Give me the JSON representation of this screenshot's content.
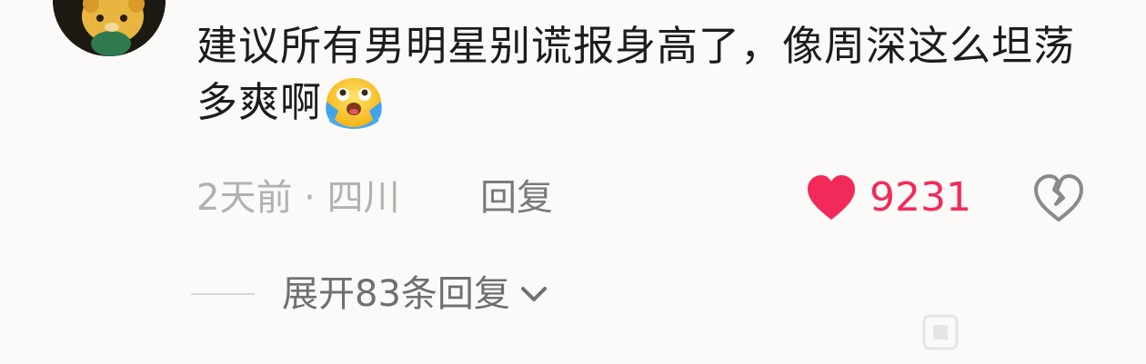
{
  "comment": {
    "text": "建议所有男明星别谎报身高了，像周深这么坦荡多爽啊",
    "emoji": "crying-laugh-emoji"
  },
  "meta": {
    "time_location": "2天前 · 四川",
    "reply_label": "回复",
    "like_count": "9231"
  },
  "expand": {
    "label": "展开83条回复"
  },
  "colors": {
    "background": "#fbfaf8",
    "text": "#1c1c1c",
    "muted": "#b1b1b1",
    "like": "#f22a59"
  }
}
